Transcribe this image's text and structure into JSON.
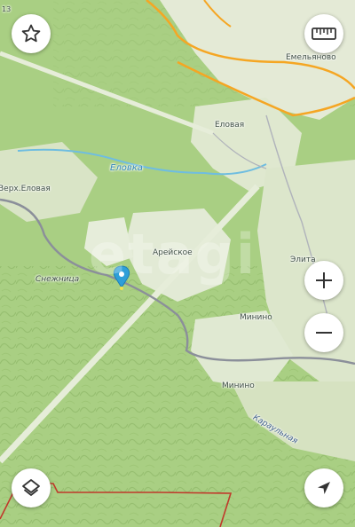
{
  "map": {
    "zoom_level": "13",
    "watermark": "etagi",
    "labels": {
      "emelyanovo": "Емельяново",
      "elovaya": "Еловая",
      "elovka_river": "Еловка",
      "verkh_elovaya": "Верх.Еловая",
      "areyskoe": "Арейское",
      "elita": "Элита",
      "snezhnitsa": "Снежница",
      "minino_1": "Минино",
      "minino_2": "Минино",
      "karaulnaya": "Караульная"
    },
    "colors": {
      "forest": "#a9cf83",
      "open_land": "#dfe8cf",
      "road_orange": "#f5a623",
      "road_grey": "#8b8f9a",
      "boundary": "#c0392b",
      "marker": "#2f9fd8"
    }
  },
  "controls": {
    "favorite_icon": "star-icon",
    "ruler_icon": "ruler-icon",
    "zoom_in_icon": "plus-icon",
    "zoom_out_icon": "minus-icon",
    "layers_icon": "layers-icon",
    "locate_icon": "navigation-arrow-icon"
  }
}
